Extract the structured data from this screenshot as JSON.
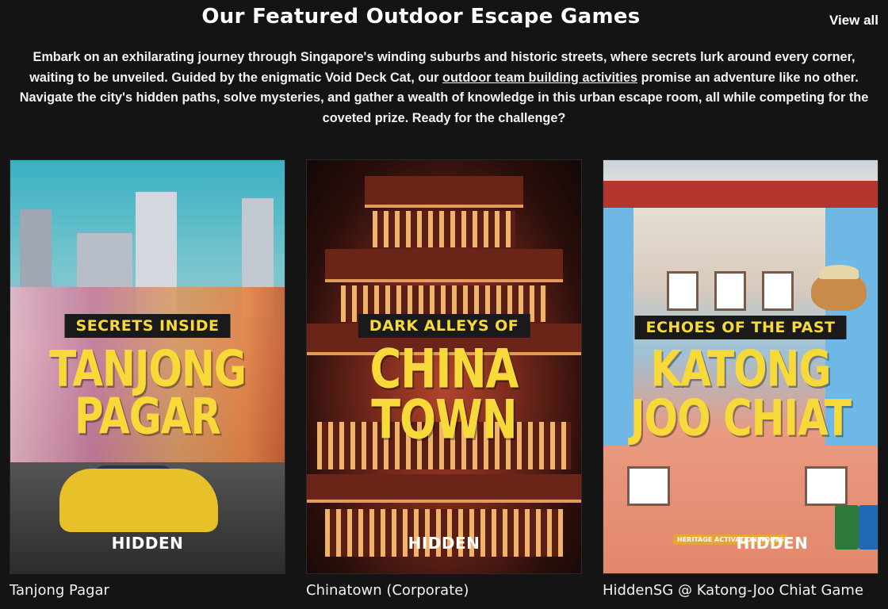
{
  "heading": "Our Featured Outdoor Escape Games",
  "view_all": "View all",
  "intro": {
    "before": "Embark on an exhilarating journey through Singapore's winding suburbs and historic streets, where secrets lurk around every corner, waiting to be unveiled. Guided by the enigmatic Void Deck Cat, our ",
    "link": "outdoor team building activities",
    "after": " promise an adventure like no other. Navigate the city's hidden paths, solve mysteries, and gather a wealth of knowledge in this urban escape room, all while competing for the coveted prize. Ready for the challenge?"
  },
  "cards": [
    {
      "tagline": "SECRETS INSIDE",
      "title_line1": "TANJONG",
      "title_line2": "PAGAR",
      "brand": "HIDDEN",
      "caption": "Tanjong Pagar"
    },
    {
      "tagline": "DARK ALLEYS OF",
      "title_line1": "CHINA",
      "title_line2": "TOWN",
      "brand": "HIDDEN",
      "caption": "Chinatown (Corporate)"
    },
    {
      "tagline": "ECHOES OF THE PAST",
      "title_line1": "KATONG",
      "title_line2": "JOO CHIAT",
      "brand": "HIDDEN",
      "badge": "HERITAGE ACTIVATION NODES",
      "caption": "HiddenSG @ Katong-Joo Chiat Game"
    }
  ],
  "colors": {
    "background": "#141414",
    "poster_title": "#f7d93a",
    "text": "#f2f2f2"
  }
}
